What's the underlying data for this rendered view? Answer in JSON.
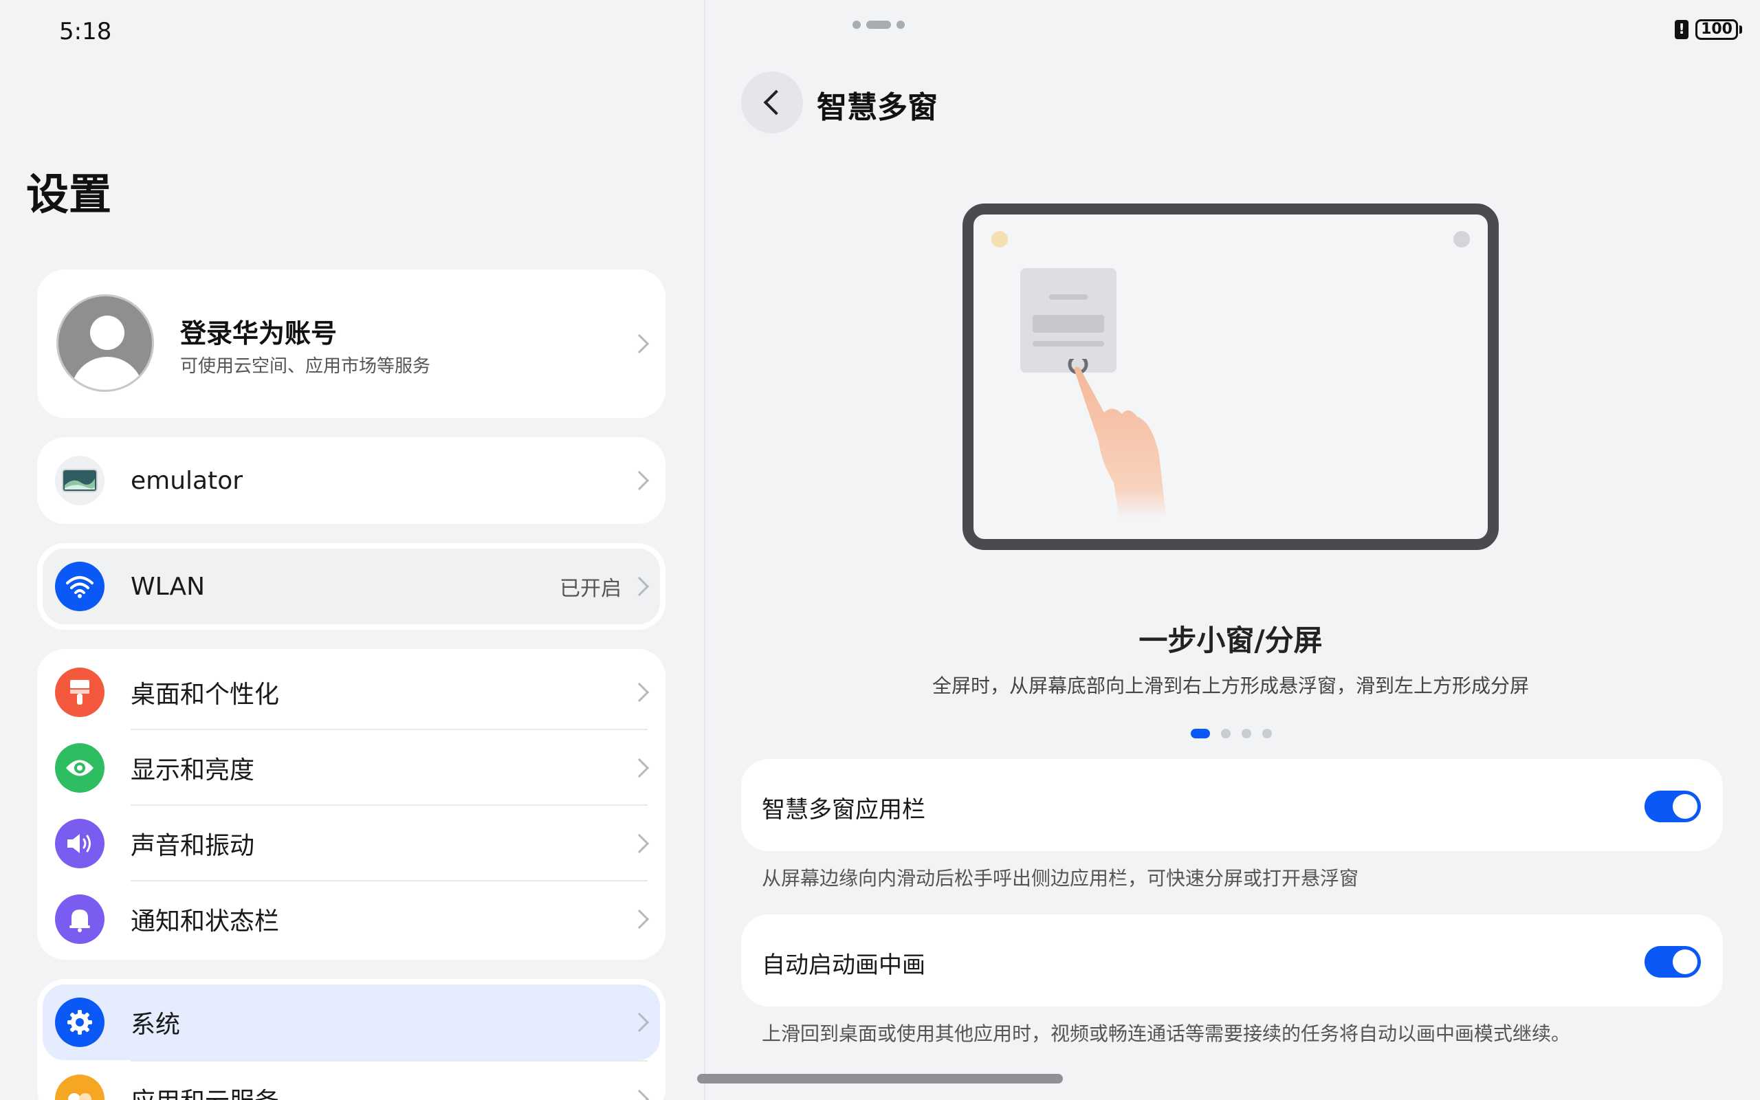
{
  "status_bar": {
    "time": "5:18",
    "battery_level": "100",
    "alert_icon": "battery-alert-icon"
  },
  "left": {
    "title": "设置",
    "account": {
      "title": "登录华为账号",
      "subtitle": "可使用云空间、应用市场等服务",
      "icon": "avatar-icon"
    },
    "device": {
      "label": "emulator",
      "icon": "device-thumbnail-icon"
    },
    "wlan": {
      "label": "WLAN",
      "value": "已开启",
      "icon": "wifi-icon",
      "color": "#0a59f7"
    },
    "group": [
      {
        "label": "桌面和个性化",
        "icon": "brush-icon",
        "color": "#f5593d"
      },
      {
        "label": "显示和亮度",
        "icon": "eye-icon",
        "color": "#2fbd61"
      },
      {
        "label": "声音和振动",
        "icon": "speaker-icon",
        "color": "#7b5cf0"
      },
      {
        "label": "通知和状态栏",
        "icon": "bell-icon",
        "color": "#7b5cf0"
      }
    ],
    "system": {
      "label": "系统",
      "icon": "gear-icon",
      "color": "#0a59f7"
    },
    "apps": {
      "label": "应用和云服务",
      "icon": "apps-icon",
      "color": "#f5a623"
    }
  },
  "right": {
    "title": "智慧多窗",
    "feature_title": "一步小窗/分屏",
    "feature_desc": "全屏时，从屏幕底部向上滑到右上方形成悬浮窗，滑到左上方形成分屏",
    "pager": {
      "count": 4,
      "active": 0
    },
    "settings": [
      {
        "label": "智慧多窗应用栏",
        "enabled": true,
        "desc": "从屏幕边缘向内滑动后松手呼出侧边应用栏，可快速分屏或打开悬浮窗"
      },
      {
        "label": "自动启动画中画",
        "enabled": true,
        "desc": "上滑回到桌面或使用其他应用时，视频或畅连通话等需要接续的任务将自动以画中画模式继续。"
      }
    ]
  },
  "accent": "#0a59f7"
}
